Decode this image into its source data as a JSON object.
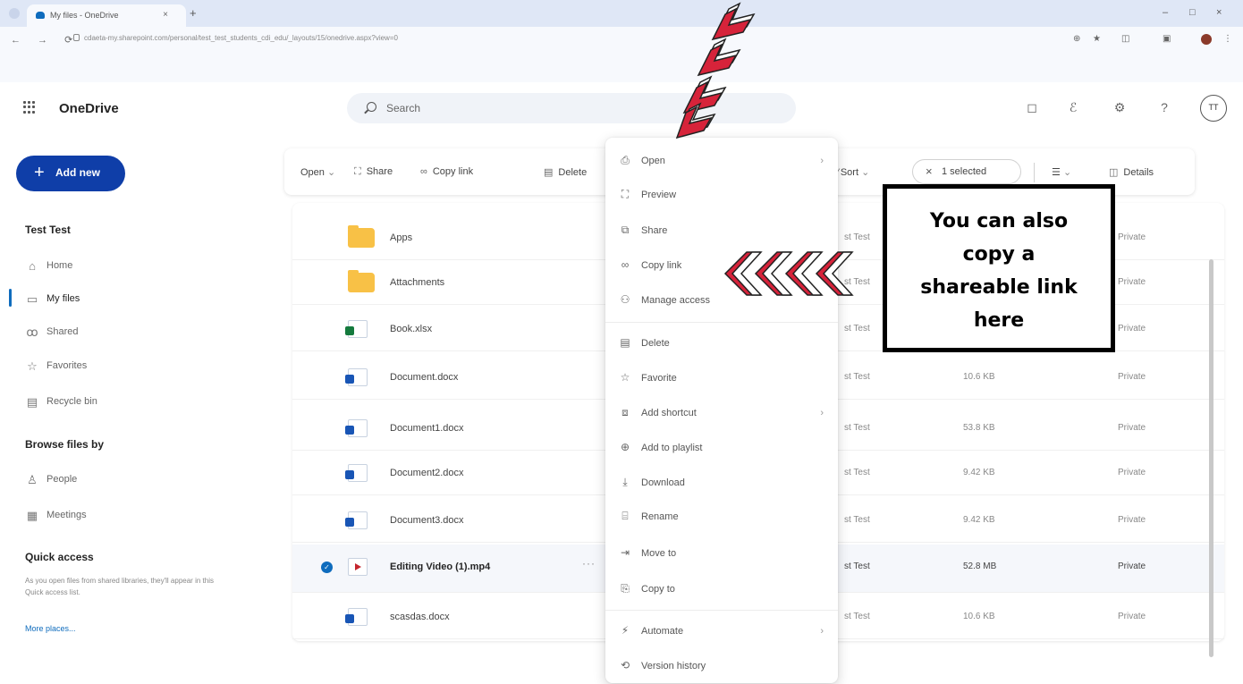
{
  "browser": {
    "tab_title": "My files - OneDrive",
    "tab_close": "×",
    "new_tab": "+",
    "url": "cdaeta-my.sharepoint.com/personal/test_test_students_cdi_edu/_layouts/15/onedrive.aspx?view=0",
    "nav": "← → ⟳",
    "minimize": "–",
    "maximize": "□",
    "close": "×"
  },
  "app": {
    "name": "OneDrive",
    "search_placeholder": "Search",
    "avatar": "TT"
  },
  "sidebar": {
    "add_new": "Add new",
    "user": "Test Test",
    "items": [
      {
        "label": "Home",
        "icon": "home-icon"
      },
      {
        "label": "My files",
        "icon": "folder-icon"
      },
      {
        "label": "Shared",
        "icon": "people-icon"
      },
      {
        "label": "Favorites",
        "icon": "star-icon"
      },
      {
        "label": "Recycle bin",
        "icon": "trash-icon"
      }
    ],
    "browse_header": "Browse files by",
    "browse_items": [
      {
        "label": "People",
        "icon": "person-icon"
      },
      {
        "label": "Meetings",
        "icon": "calendar-icon"
      }
    ],
    "quick_access_header": "Quick access",
    "quick_access_note": "As you open files from shared libraries, they'll appear in this Quick access list.",
    "more_places": "More places..."
  },
  "commandbar": {
    "open": "Open",
    "share": "Share",
    "copy_link": "Copy link",
    "delete": "Delete",
    "sort": "Sort",
    "selected": "1 selected",
    "details": "Details"
  },
  "files": [
    {
      "name": "Apps",
      "type": "folder",
      "owner": "st Test",
      "size": "",
      "sharing": "Private"
    },
    {
      "name": "Attachments",
      "type": "folder",
      "owner": "st Test",
      "size": "",
      "sharing": "Private"
    },
    {
      "name": "Book.xlsx",
      "type": "excel",
      "owner": "st Test",
      "size": "",
      "sharing": "Private"
    },
    {
      "name": "Document.docx",
      "type": "word",
      "owner": "st Test",
      "size": "10.6 KB",
      "sharing": "Private"
    },
    {
      "name": "Document1.docx",
      "type": "word",
      "owner": "st Test",
      "size": "53.8 KB",
      "sharing": "Private"
    },
    {
      "name": "Document2.docx",
      "type": "word",
      "owner": "st Test",
      "size": "9.42 KB",
      "sharing": "Private"
    },
    {
      "name": "Document3.docx",
      "type": "word",
      "owner": "st Test",
      "size": "9.42 KB",
      "sharing": "Private"
    },
    {
      "name": "Editing Video (1).mp4",
      "type": "video",
      "owner": "st Test",
      "size": "52.8 MB",
      "sharing": "Private",
      "selected": true
    },
    {
      "name": "scasdas.docx",
      "type": "word",
      "owner": "st Test",
      "size": "10.6 KB",
      "sharing": "Private"
    }
  ],
  "context_menu": [
    {
      "label": "Open",
      "icon": "open-icon",
      "submenu": true
    },
    {
      "label": "Preview",
      "icon": "preview-icon"
    },
    {
      "label": "Share",
      "icon": "share-icon"
    },
    {
      "label": "Copy link",
      "icon": "link-icon"
    },
    {
      "label": "Manage access",
      "icon": "manage-access-icon"
    },
    {
      "label": "Delete",
      "icon": "trash-icon"
    },
    {
      "label": "Favorite",
      "icon": "star-icon"
    },
    {
      "label": "Add shortcut",
      "icon": "shortcut-icon",
      "submenu": true
    },
    {
      "label": "Add to playlist",
      "icon": "playlist-icon"
    },
    {
      "label": "Download",
      "icon": "download-icon"
    },
    {
      "label": "Rename",
      "icon": "rename-icon"
    },
    {
      "label": "Move to",
      "icon": "move-icon"
    },
    {
      "label": "Copy to",
      "icon": "copy-icon"
    },
    {
      "label": "Automate",
      "icon": "automate-icon",
      "submenu": true
    },
    {
      "label": "Version history",
      "icon": "history-icon"
    }
  ],
  "annotation": {
    "lines": [
      "You can also",
      "copy a",
      "shareable link",
      "here"
    ]
  },
  "colors": {
    "accent": "#0f6cbd",
    "add_new_bg": "#0f3ea8",
    "arrow_red": "#d6233a",
    "folder": "#f8c146"
  }
}
